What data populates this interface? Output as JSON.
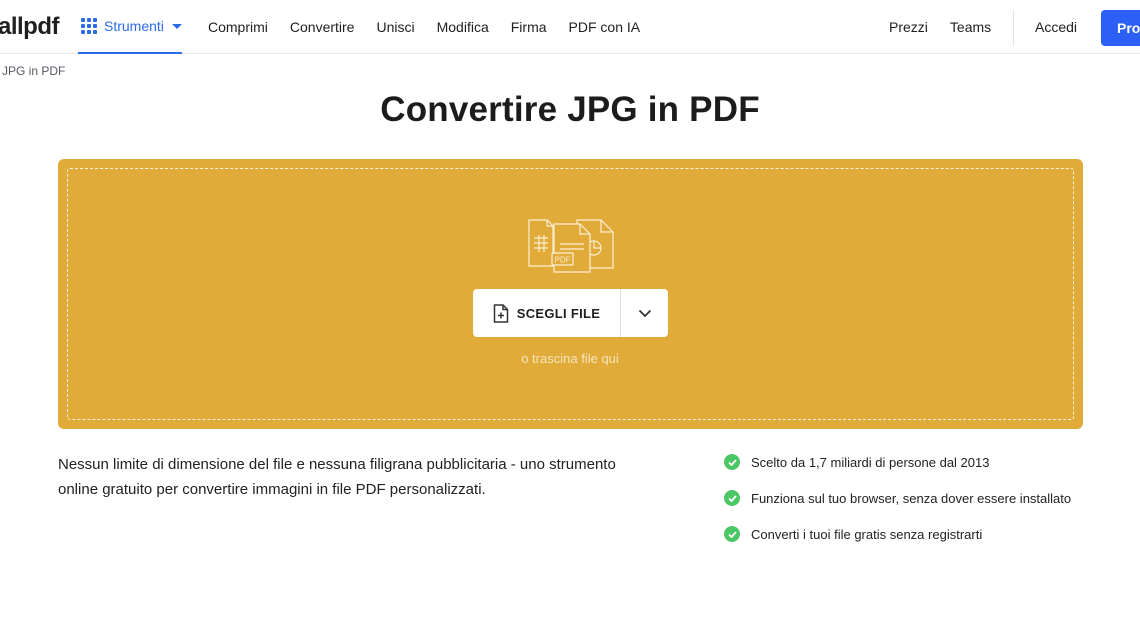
{
  "header": {
    "logo": "allpdf",
    "tools_label": "Strumenti",
    "nav_left": [
      "Comprimi",
      "Convertire",
      "Unisci",
      "Modifica",
      "Firma",
      "PDF con IA"
    ],
    "nav_right": [
      "Prezzi",
      "Teams"
    ],
    "login": "Accedi",
    "pro_button": "Prova"
  },
  "breadcrumb": "JPG in PDF",
  "title": "Convertire JPG in PDF",
  "dropzone": {
    "illustration_label": "PDF",
    "choose_label": "SCEGLI FILE",
    "drag_hint": "o trascina file qui"
  },
  "description": "Nessun limite di dimensione del file e nessuna filigrana pubblicitaria - uno strumento online gratuito per convertire immagini in file PDF personalizzati.",
  "features": [
    "Scelto da 1,7 miliardi di persone dal 2013",
    "Funziona sul tuo browser, senza dover essere installato",
    "Converti i tuoi file gratis senza registrarti"
  ],
  "colors": {
    "accent": "#2b6be8",
    "pro_button": "#2b5ff5",
    "dropzone": "#e0ab38",
    "check": "#4cc766"
  },
  "icons": {
    "tools": "grid-icon",
    "tools_caret": "caret-down-icon",
    "choose": "file-add-icon",
    "dropdown": "chevron-down-icon",
    "feature": "check-circle-icon"
  }
}
